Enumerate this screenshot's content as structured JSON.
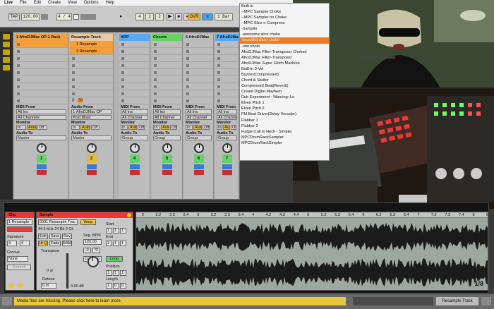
{
  "menubar": {
    "app": "Live",
    "items": [
      "File",
      "Edit",
      "Create",
      "View",
      "Options",
      "Help"
    ]
  },
  "transport": {
    "tap": "TAP",
    "tempo": "120.00",
    "sig": "4 / 4",
    "pos1": "4",
    "pos2": "2",
    "pos3": "2",
    "ovr": "OVR",
    "loop_len": "1 Bar"
  },
  "tracks": [
    {
      "name": "1 AfroDJMac OP-1 Rack",
      "color": "#f0a040",
      "num": "1",
      "midi_from": "All Ins",
      "channel": "All Channels",
      "monitor": [
        "In",
        "Auto",
        "Off"
      ],
      "audio_to": "Master",
      "clip": ""
    },
    {
      "name": "Resample Track",
      "color": "#e8c8a0",
      "num": "2",
      "midi_from": "1-AfroDJMac OP",
      "channel": "Post Mixer",
      "monitor": [
        "In",
        "Auto",
        "Off"
      ],
      "audio_to": "Master",
      "clip": "1 Resample",
      "clip2": "2 Resample"
    },
    {
      "name": "ARP",
      "color": "#58a8f8",
      "num": "4",
      "midi_from": "All Ins",
      "channel": "All Channel",
      "monitor": [
        "In",
        "Auto",
        "Off"
      ],
      "audio_to": "Group"
    },
    {
      "name": "Chords",
      "color": "#6ad068",
      "num": "5",
      "midi_from": "All Ins",
      "channel": "All Channel",
      "monitor": [
        "In",
        "Auto",
        "Off"
      ],
      "audio_to": "Group"
    },
    {
      "name": "6 AfroDJMac",
      "color": "#bcbcbc",
      "num": "6",
      "midi_from": "All Ins",
      "channel": "All Channel",
      "monitor": [
        "In",
        "Auto",
        "Off"
      ],
      "audio_to": "Group"
    },
    {
      "name": "7 AfroDJMac",
      "color": "#58a8f8",
      "num": "7",
      "midi_from": "All Ins",
      "channel": "All Channe",
      "monitor": [
        "In",
        "Auto",
        "Off"
      ],
      "audio_to": "Group"
    }
  ],
  "io_labels": {
    "midi_from": "MIDI From",
    "audio_from": "Audio From",
    "monitor": "Monitor",
    "audio_to": "Audio To",
    "clip_stop_vals": [
      "0",
      "36"
    ]
  },
  "dropdown": {
    "items": [
      "Built-in",
      "--MPC Sampler Choke",
      "--MPC Sampler no Choke",
      "--MPC Slice n Compress",
      "-Sampler",
      "-awesome slice choke",
      "-beautiful slicer choke",
      "-one shots",
      "AfroDJMac Filter-Transposer Choked",
      "AfroDJMac Filter-Transposer",
      "AfroDJMac Super Glitch Machine",
      "Built-in 0-Vel",
      "Buzzer(Compressed)",
      "Chord & Stutter",
      "Compressed Beat(Reverb)",
      "Create Digital Mayhem",
      "Dub Experiment - Warning: Lo",
      "Elven Pitch 1",
      "Elven Pitch 2",
      "FM Beat Driver(Delay-Vocoder)",
      "Flabber 1",
      "Flabber 2",
      "Fudge it all to Heck - Simpler",
      "MPCDrumRackSampler",
      "MPCDrumRackSimpler"
    ],
    "selected_index": 6
  },
  "clip": {
    "title": "Clip",
    "name": "1 Resample",
    "signature_label": "Signature",
    "sig_num": "4",
    "sig_den": "4",
    "groove_label": "Groove",
    "groove_val": "None",
    "commit": "Commit"
  },
  "sample": {
    "title": "Sample",
    "file": "0001 Resample Trac",
    "rate": "44.1 kHz 24 Bit 2 Ch",
    "edit": "Edit",
    "save": "Save",
    "rev": "Rev",
    "hiq": "Hi-Q",
    "fade": "Fade",
    "ram": "RAM",
    "warp": "Warp",
    "seg_label": "Seg. BPM",
    "seg_bpm": "120.00",
    "half": ":2",
    "dbl": "*2",
    "mode": "Complex",
    "transpose_label": "Transpose",
    "transpose_val": "0 st",
    "detune_label": "Detune",
    "detune_val": "0 ct",
    "gain_val": "0.00 dB",
    "start_label": "Start",
    "end_label": "End",
    "loop_label": "Loop",
    "position_label": "Position",
    "length_label": "Length",
    "start": [
      "1",
      "1",
      "1"
    ],
    "end": [
      "2",
      "1",
      "1"
    ],
    "position": [
      "1",
      "1",
      "1"
    ],
    "length": [
      "1",
      "0",
      "0"
    ]
  },
  "wave": {
    "ruler": [
      "2",
      "2.2",
      "2.3",
      "2.4",
      "3",
      "3.2",
      "3.3",
      "3.4",
      "4",
      "4.2",
      "4.3",
      "4.4",
      "5",
      "5.2",
      "5.3",
      "5.4",
      "6",
      "6.2",
      "6.3",
      "6.4",
      "7",
      "7.2",
      "7.3",
      "7.4",
      "8",
      "8.2"
    ],
    "zoom": "1/8"
  },
  "status": {
    "message": "Media files are missing. Please click here to learn more.",
    "track": "Resample Track"
  }
}
